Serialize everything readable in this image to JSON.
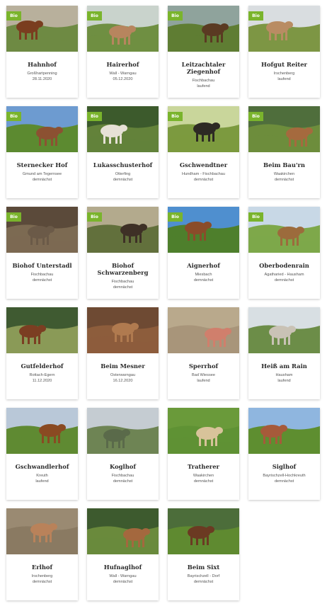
{
  "badge_label": "Bio",
  "accent_color": "#7ab42c",
  "farms": [
    {
      "name": "Hahnhof",
      "place": "Großhartpenning",
      "status": "28.11.2020",
      "bio": true,
      "sky": "#b8b09c",
      "ground": "#6e8a43",
      "cow": "#7a3d1f"
    },
    {
      "name": "Hairerhof",
      "place": "Wall - Warngau",
      "status": "05.12.2020",
      "bio": true,
      "sky": "#c9d3cc",
      "ground": "#6f8f42",
      "cow": "#b7855e"
    },
    {
      "name": "Leitzachtaler Ziegenhof",
      "place": "Fischbachau",
      "status": "laufend",
      "bio": true,
      "sky": "#8fa39c",
      "ground": "#5f7d33",
      "cow": "#5a3a22"
    },
    {
      "name": "Hofgut Reiter",
      "place": "Irschenberg",
      "status": "laufend",
      "bio": true,
      "sky": "#d9dde0",
      "ground": "#7d9644",
      "cow": "#b98c63"
    },
    {
      "name": "Sternecker Hof",
      "place": "Gmund am Tegernsee",
      "status": "demnächst",
      "bio": true,
      "sky": "#6d9bd0",
      "ground": "#5c8a30",
      "cow": "#8c5132"
    },
    {
      "name": "Lukasschusterhof",
      "place": "Otterfing",
      "status": "demnächst",
      "bio": true,
      "sky": "#3c5a2c",
      "ground": "#63823a",
      "cow": "#e6e1d6"
    },
    {
      "name": "Gschwendtner",
      "place": "Hundham - Fischbachau",
      "status": "demnächst",
      "bio": true,
      "sky": "#c9d69b",
      "ground": "#7c9a3f",
      "cow": "#2d2a24"
    },
    {
      "name": "Beim Bau'rn",
      "place": "Waakirchen",
      "status": "demnächst",
      "bio": true,
      "sky": "#4f6e3c",
      "ground": "#6d8d3c",
      "cow": "#a56a3e"
    },
    {
      "name": "Biohof Unterstadl",
      "place": "Fischbachau",
      "status": "demnächst",
      "bio": true,
      "sky": "#5b4a3a",
      "ground": "#7c6a52",
      "cow": "#6b5a48"
    },
    {
      "name": "Biohof Schwarzenberg",
      "place": "Fischbachau",
      "status": "demnächst",
      "bio": true,
      "sky": "#b3aa8d",
      "ground": "#62703c",
      "cow": "#3e3026"
    },
    {
      "name": "Aignerhof",
      "place": "Miesbach",
      "status": "demnächst",
      "bio": true,
      "sky": "#4f8fcf",
      "ground": "#4e7f2c",
      "cow": "#8a4c2a"
    },
    {
      "name": "Oberbodenrain",
      "place": "Agatharied - Hausham",
      "status": "demnächst",
      "bio": true,
      "sky": "#c8d8e6",
      "ground": "#7ea84a",
      "cow": "#9c6b3c"
    },
    {
      "name": "Gutfelderhof",
      "place": "Rottach-Egern",
      "status": "11.12.2020",
      "bio": false,
      "sky": "#3f5a31",
      "ground": "#8a9a57",
      "cow": "#7b3e22"
    },
    {
      "name": "Beim Mesner",
      "place": "Osterwarngau",
      "status": "16.12.2020",
      "bio": false,
      "sky": "#6e4a33",
      "ground": "#8d5d3c",
      "cow": "#b07a4f"
    },
    {
      "name": "Sperrhof",
      "place": "Bad Wiessee",
      "status": "laufend",
      "bio": false,
      "sky": "#b9a98c",
      "ground": "#a8957a",
      "cow": "#d07f6c"
    },
    {
      "name": "Heiß am Rain",
      "place": "Hausham",
      "status": "laufend",
      "bio": false,
      "sky": "#d8dfe3",
      "ground": "#6c8d48",
      "cow": "#c9c2b5"
    },
    {
      "name": "Gschwandlerhof",
      "place": "Kreuth",
      "status": "laufend",
      "bio": false,
      "sky": "#b9c8d8",
      "ground": "#5f8a32",
      "cow": "#8a4a22"
    },
    {
      "name": "Koglhof",
      "place": "Fischbachau",
      "status": "demnächst",
      "bio": false,
      "sky": "#c5ccd2",
      "ground": "#6e8454",
      "cow": "#5a6a4a"
    },
    {
      "name": "Tratherer",
      "place": "Waakirchen",
      "status": "demnächst",
      "bio": false,
      "sky": "#6a9a3a",
      "ground": "#5f9234",
      "cow": "#d8c39a"
    },
    {
      "name": "Siglhof",
      "place": "Bayrischzell-Hochkreuth",
      "status": "demnächst",
      "bio": false,
      "sky": "#8fb6df",
      "ground": "#5e8e30",
      "cow": "#a65a3a"
    },
    {
      "name": "Erlhof",
      "place": "Irschenberg",
      "status": "demnächst",
      "bio": false,
      "sky": "#9a8a72",
      "ground": "#8a7a62",
      "cow": "#b9825a"
    },
    {
      "name": "Hufnaglhof",
      "place": "Wall - Warngau",
      "status": "demnächst",
      "bio": false,
      "sky": "#3d5a2e",
      "ground": "#6a8a3c",
      "cow": "#a4683e"
    },
    {
      "name": "Beim Sixt",
      "place": "Bayrischzell - Dorf",
      "status": "demnächst",
      "bio": false,
      "sky": "#4c6d3a",
      "ground": "#5f8a30",
      "cow": "#6b3a22"
    }
  ]
}
